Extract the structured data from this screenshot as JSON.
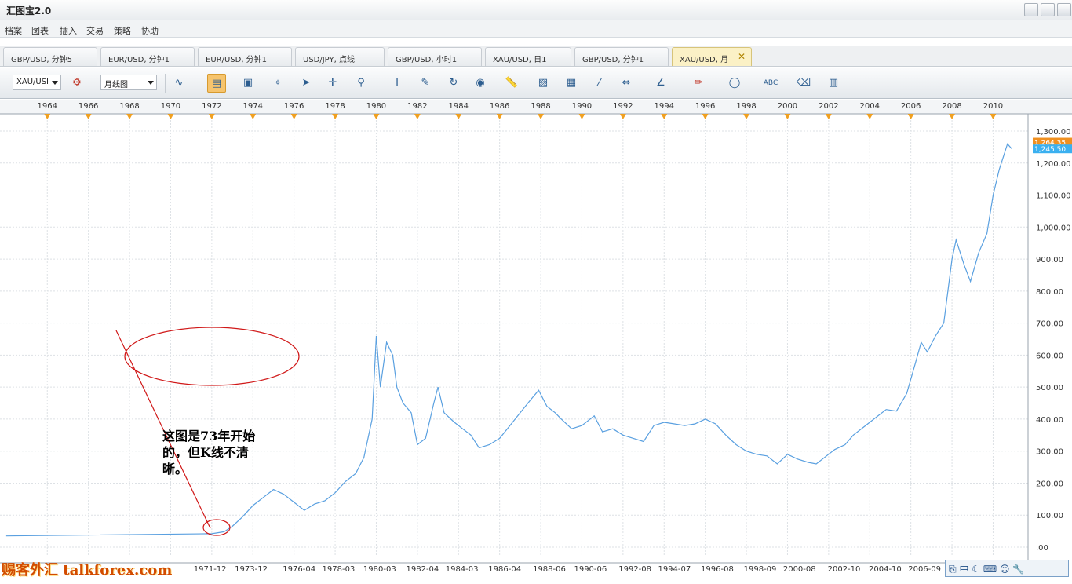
{
  "app": {
    "title": "汇图宝2.0"
  },
  "menu": [
    "档案",
    "图表",
    "插入",
    "交易",
    "策略",
    "协助"
  ],
  "tabs": [
    {
      "label": "GBP/USD, 分钟5",
      "active": false
    },
    {
      "label": "EUR/USD, 分钟1",
      "active": false
    },
    {
      "label": "EUR/USD, 分钟1",
      "active": false
    },
    {
      "label": "USD/JPY, 点线",
      "active": false
    },
    {
      "label": "GBP/USD, 小时1",
      "active": false
    },
    {
      "label": "XAU/USD, 日1",
      "active": false
    },
    {
      "label": "GBP/USD, 分钟1",
      "active": false
    },
    {
      "label": "XAU/USD, 月",
      "active": true
    }
  ],
  "toolbar": {
    "symbol": "XAU/USI",
    "chart_type": "月线图",
    "icons": [
      "search-indicator-icon",
      "wave-icon",
      "chart-bar-icon",
      "window-icon",
      "zoom-icon",
      "crosshair-icon",
      "text-icon",
      "image-icon",
      "ruler-icon",
      "line-icon",
      "pencil-icon",
      "ellipse-icon",
      "abc-icon",
      "eraser-icon"
    ]
  },
  "chart_data": {
    "type": "line",
    "series": [
      {
        "values": [
          [
            1962.0,
            35
          ],
          [
            1972.0,
            42
          ],
          [
            1972.6,
            48
          ],
          [
            1973.0,
            65
          ],
          [
            1973.5,
            95
          ],
          [
            1974.0,
            130
          ],
          [
            1974.5,
            155
          ],
          [
            1975.0,
            180
          ],
          [
            1975.5,
            165
          ],
          [
            1976.0,
            140
          ],
          [
            1976.5,
            115
          ],
          [
            1977.0,
            135
          ],
          [
            1977.5,
            145
          ],
          [
            1978.0,
            170
          ],
          [
            1978.5,
            205
          ],
          [
            1979.0,
            230
          ],
          [
            1979.4,
            280
          ],
          [
            1979.8,
            400
          ],
          [
            1980.0,
            660
          ],
          [
            1980.2,
            500
          ],
          [
            1980.5,
            640
          ],
          [
            1980.8,
            600
          ],
          [
            1981.0,
            500
          ],
          [
            1981.3,
            450
          ],
          [
            1981.7,
            420
          ],
          [
            1982.0,
            320
          ],
          [
            1982.4,
            340
          ],
          [
            1982.8,
            450
          ],
          [
            1983.0,
            500
          ],
          [
            1983.3,
            420
          ],
          [
            1983.8,
            390
          ],
          [
            1984.2,
            370
          ],
          [
            1984.6,
            350
          ],
          [
            1985.0,
            310
          ],
          [
            1985.5,
            320
          ],
          [
            1986.0,
            340
          ],
          [
            1986.5,
            380
          ],
          [
            1987.0,
            420
          ],
          [
            1987.5,
            460
          ],
          [
            1987.9,
            490
          ],
          [
            1988.3,
            440
          ],
          [
            1988.7,
            420
          ],
          [
            1989.0,
            400
          ],
          [
            1989.5,
            370
          ],
          [
            1990.0,
            380
          ],
          [
            1990.6,
            410
          ],
          [
            1991.0,
            360
          ],
          [
            1991.5,
            370
          ],
          [
            1992.0,
            350
          ],
          [
            1992.5,
            340
          ],
          [
            1993.0,
            330
          ],
          [
            1993.5,
            380
          ],
          [
            1994.0,
            390
          ],
          [
            1994.5,
            385
          ],
          [
            1995.0,
            380
          ],
          [
            1995.5,
            385
          ],
          [
            1996.0,
            400
          ],
          [
            1996.5,
            385
          ],
          [
            1997.0,
            350
          ],
          [
            1997.5,
            320
          ],
          [
            1998.0,
            300
          ],
          [
            1998.5,
            290
          ],
          [
            1999.0,
            285
          ],
          [
            1999.5,
            260
          ],
          [
            2000.0,
            290
          ],
          [
            2000.5,
            275
          ],
          [
            2001.0,
            265
          ],
          [
            2001.4,
            260
          ],
          [
            2001.8,
            280
          ],
          [
            2002.3,
            305
          ],
          [
            2002.8,
            320
          ],
          [
            2003.2,
            350
          ],
          [
            2003.8,
            380
          ],
          [
            2004.2,
            400
          ],
          [
            2004.8,
            430
          ],
          [
            2005.3,
            425
          ],
          [
            2005.8,
            480
          ],
          [
            2006.2,
            570
          ],
          [
            2006.5,
            640
          ],
          [
            2006.8,
            610
          ],
          [
            2007.2,
            660
          ],
          [
            2007.6,
            700
          ],
          [
            2008.0,
            900
          ],
          [
            2008.2,
            960
          ],
          [
            2008.6,
            880
          ],
          [
            2008.9,
            830
          ],
          [
            2009.3,
            920
          ],
          [
            2009.7,
            980
          ],
          [
            2010.0,
            1100
          ],
          [
            2010.3,
            1180
          ],
          [
            2010.7,
            1260
          ],
          [
            2010.9,
            1245
          ]
        ]
      }
    ],
    "x_ticks_top": [
      "1964",
      "1966",
      "1968",
      "1970",
      "1972",
      "1974",
      "1976",
      "1978",
      "1980",
      "1982",
      "1984",
      "1986",
      "1988",
      "1990",
      "1992",
      "1994",
      "1996",
      "1998",
      "2000",
      "2002",
      "2004",
      "2006",
      "2008",
      "2010"
    ],
    "x_ticks_bottom": [
      "1971-12",
      "1973-12",
      "1976-04",
      "1978-03",
      "1980-03",
      "1982-04",
      "1984-03",
      "1986-04",
      "1988-06",
      "1990-06",
      "1992-08",
      "1994-07",
      "1996-08",
      "1998-09",
      "2000-08",
      "2002-10",
      "2004-10",
      "2006-09"
    ],
    "y_ticks": [
      "1,300.00",
      "1,200.00",
      "1,100.00",
      "1,000.00",
      "900.00",
      "800.00",
      "700.00",
      "600.00",
      "500.00",
      "400.00",
      "300.00",
      "200.00",
      "100.00",
      ".00"
    ],
    "y_min": 0,
    "y_max": 1300,
    "price_labels": [
      "1,264.35",
      "1,245.50"
    ],
    "annotation": "这图是73年开始的，但K线不清晰。"
  },
  "watermark": "赐客外汇 talkforex.com",
  "status": {
    "lang": "中"
  }
}
